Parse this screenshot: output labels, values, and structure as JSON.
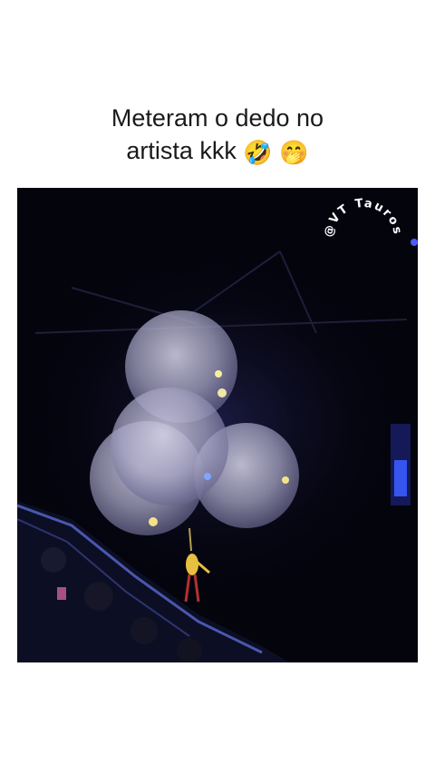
{
  "caption": {
    "line1": "Meteram o dedo no",
    "line2": "artista kkk",
    "emojis": [
      "🤣",
      "🤭"
    ]
  },
  "video": {
    "watermark": "@VT Tauros"
  },
  "colors": {
    "background": "#ffffff",
    "video_bg": "#04040d",
    "caption_text": "#1a1a1a"
  }
}
